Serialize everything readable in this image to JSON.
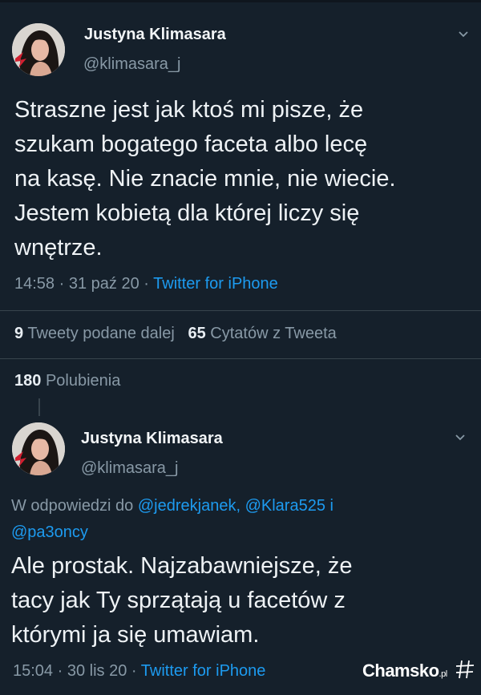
{
  "tweet": {
    "author_name": "Justyna Klimasara",
    "author_handle": "@klimasara_j",
    "text_lines": [
      "Straszne jest jak ktoś mi pisze, że",
      "szukam bogatego faceta albo lecę",
      "na kasę. Nie znacie mnie, nie wiecie.",
      "Jestem kobietą dla której liczy się",
      "wnętrze."
    ],
    "time": "14:58",
    "date": "31 paź 20",
    "separator": "·",
    "source": "Twitter for iPhone",
    "retweets_count": "9",
    "retweets_label": "Tweety podane dalej",
    "quotes_count": "65",
    "quotes_label": "Cytatów z Tweeta",
    "likes_count": "180",
    "likes_label": "Polubienia"
  },
  "reply": {
    "author_name": "Justyna Klimasara",
    "author_handle": "@klimasara_j",
    "reply_prefix": "W odpowiedzi do",
    "mention_1": "@jedrekjanek,",
    "mention_2": "@Klara525",
    "conjunction": "i",
    "mention_3": "@pa3oncy",
    "text_lines": [
      "Ale prostak. Najzabawniejsze, że",
      "tacy jak Ty sprzątają u facetów z",
      "którymi ja się umawiam."
    ],
    "time": "15:04",
    "date": "30 lis 20",
    "separator": "·",
    "source": "Twitter for iPhone"
  },
  "watermark": {
    "brand": "Chamsko",
    "domain": ".pl"
  },
  "colors": {
    "background": "#15202b",
    "text": "#e8eef3",
    "secondary": "#8899a6",
    "link": "#1d9bf0",
    "divider": "#38444d"
  },
  "icons": [
    "avatar-photo",
    "chevron-down-icon",
    "hash-logo-icon"
  ]
}
